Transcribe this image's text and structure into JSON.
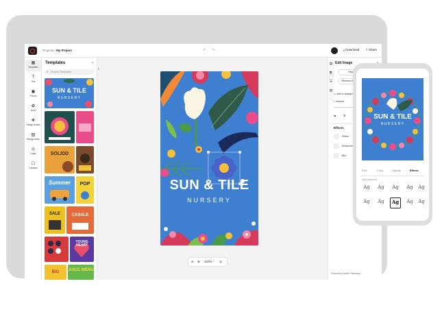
{
  "topbar": {
    "crumb_root": "Projects",
    "crumb_sep": "/",
    "crumb_current": "My Project",
    "undo_redo": "↶ ↷",
    "download_label": "Download",
    "share_label": "Share"
  },
  "rail": [
    {
      "label": "Templates",
      "icon": "templates-icon",
      "glyph": "▦",
      "active": true
    },
    {
      "label": "Text",
      "icon": "text-icon",
      "glyph": "T"
    },
    {
      "label": "Photos",
      "icon": "photos-icon",
      "glyph": "▣"
    },
    {
      "label": "Icons",
      "icon": "icons-icon",
      "glyph": "✿"
    },
    {
      "label": "Design Assets",
      "icon": "design-assets-icon",
      "glyph": "❖"
    },
    {
      "label": "Backgrounds",
      "icon": "backgrounds-icon",
      "glyph": "▨"
    },
    {
      "label": "Logos",
      "icon": "logos-icon",
      "glyph": "◎"
    },
    {
      "label": "Libraries",
      "icon": "libraries-icon",
      "glyph": "☐"
    }
  ],
  "panel": {
    "title": "Templates",
    "search_placeholder": "Search Templates",
    "templates": [
      {
        "text": "SUN & TILE",
        "sub": "NURSERY",
        "bg": "#3f7fd0"
      },
      {
        "text": "",
        "bg": "#1f4f4f"
      },
      {
        "text": "",
        "bg": "#e94e8b"
      },
      {
        "text": "SOLIDD",
        "bg": "#e9a23b"
      },
      {
        "text": "",
        "bg": "#7a4a2a"
      },
      {
        "text": "Summer",
        "bg": "#5aa0e0"
      },
      {
        "text": "POP",
        "bg": "#f3d23a"
      },
      {
        "text": "SALE",
        "bg": "#f0c020"
      },
      {
        "text": "CASALE",
        "bg": "#e46a3a"
      },
      {
        "text": "",
        "bg": "#d63a3a"
      },
      {
        "text": "YOUNG HEART",
        "bg": "#5a3aa0"
      },
      {
        "text": "BIG",
        "bg": "#f2c230"
      },
      {
        "text": "JUICE MENU",
        "bg": "#67b84a"
      }
    ]
  },
  "canvas": {
    "poster_title": "SUN & TILE",
    "poster_subtitle": "NURSERY",
    "poster_bg": "#3f7fd0",
    "zoom_value": "100%"
  },
  "right_panel": {
    "title": "Edit Image",
    "replace_label": "Replace",
    "remove_bg_label": "Remove background",
    "add_bg_label": "Add to background",
    "blend_label": "Normal",
    "effects_title": "Effects",
    "effects": [
      "Filters",
      "Enhancements",
      "Blur"
    ],
    "footer": "Powered by Adobe Photoshop"
  },
  "phone": {
    "title": "SUN & TILE",
    "subtitle": "NURSERY",
    "tabs": [
      "Font",
      "Color",
      "Opacity",
      "Effects"
    ],
    "active_tab": "Effects",
    "caption": "TEXT EFFECTS",
    "ag_label": "Ag"
  },
  "colors": {
    "accent": "#3f7fd0",
    "tablet_frame": "#d9dadc",
    "canvas_bg": "#f3f3f3"
  }
}
